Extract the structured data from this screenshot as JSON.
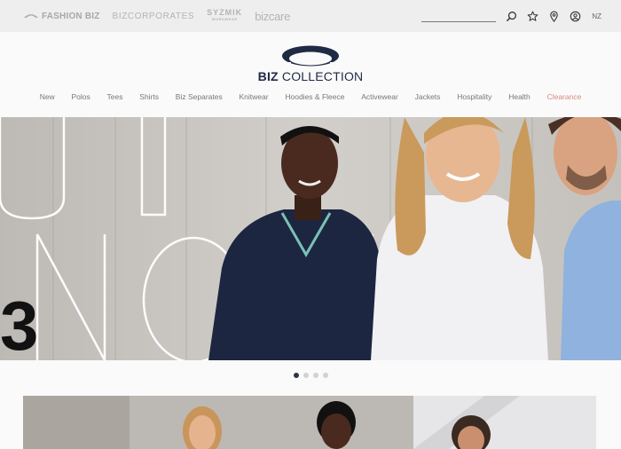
{
  "brand_bar": {
    "brands": [
      {
        "name": "FASHION BIZ",
        "icon": "fashionbiz-logo-icon"
      },
      {
        "name": "BIZCORPORATES",
        "icon": ""
      },
      {
        "name": "SYZMIK",
        "sub": "WORKWEAR",
        "icon": ""
      },
      {
        "name": "bizcare",
        "icon": ""
      }
    ]
  },
  "utility": {
    "search_placeholder": "",
    "icons": [
      "search-icon",
      "star-icon",
      "location-pin-icon",
      "user-account-icon"
    ],
    "region": "NZ"
  },
  "logo": {
    "text_bold": "BIZ",
    "text_rest": " COLLECTION",
    "color": "#1f2a44"
  },
  "nav": {
    "items": [
      {
        "label": "New"
      },
      {
        "label": "Polos"
      },
      {
        "label": "Tees"
      },
      {
        "label": "Shirts"
      },
      {
        "label": "Biz Separates"
      },
      {
        "label": "Knitwear"
      },
      {
        "label": "Hoodies & Fleece"
      },
      {
        "label": "Activewear"
      },
      {
        "label": "Jackets"
      },
      {
        "label": "Hospitality"
      },
      {
        "label": "Health"
      },
      {
        "label": "Clearance"
      }
    ],
    "sale_color": "#d98b80"
  },
  "hero": {
    "slide_number": "3",
    "outline_text": "UI NOW"
  },
  "carousel": {
    "count": 4,
    "active_index": 0
  },
  "colors": {
    "navy": "#2b3446",
    "topbar": "#eeeeee"
  }
}
